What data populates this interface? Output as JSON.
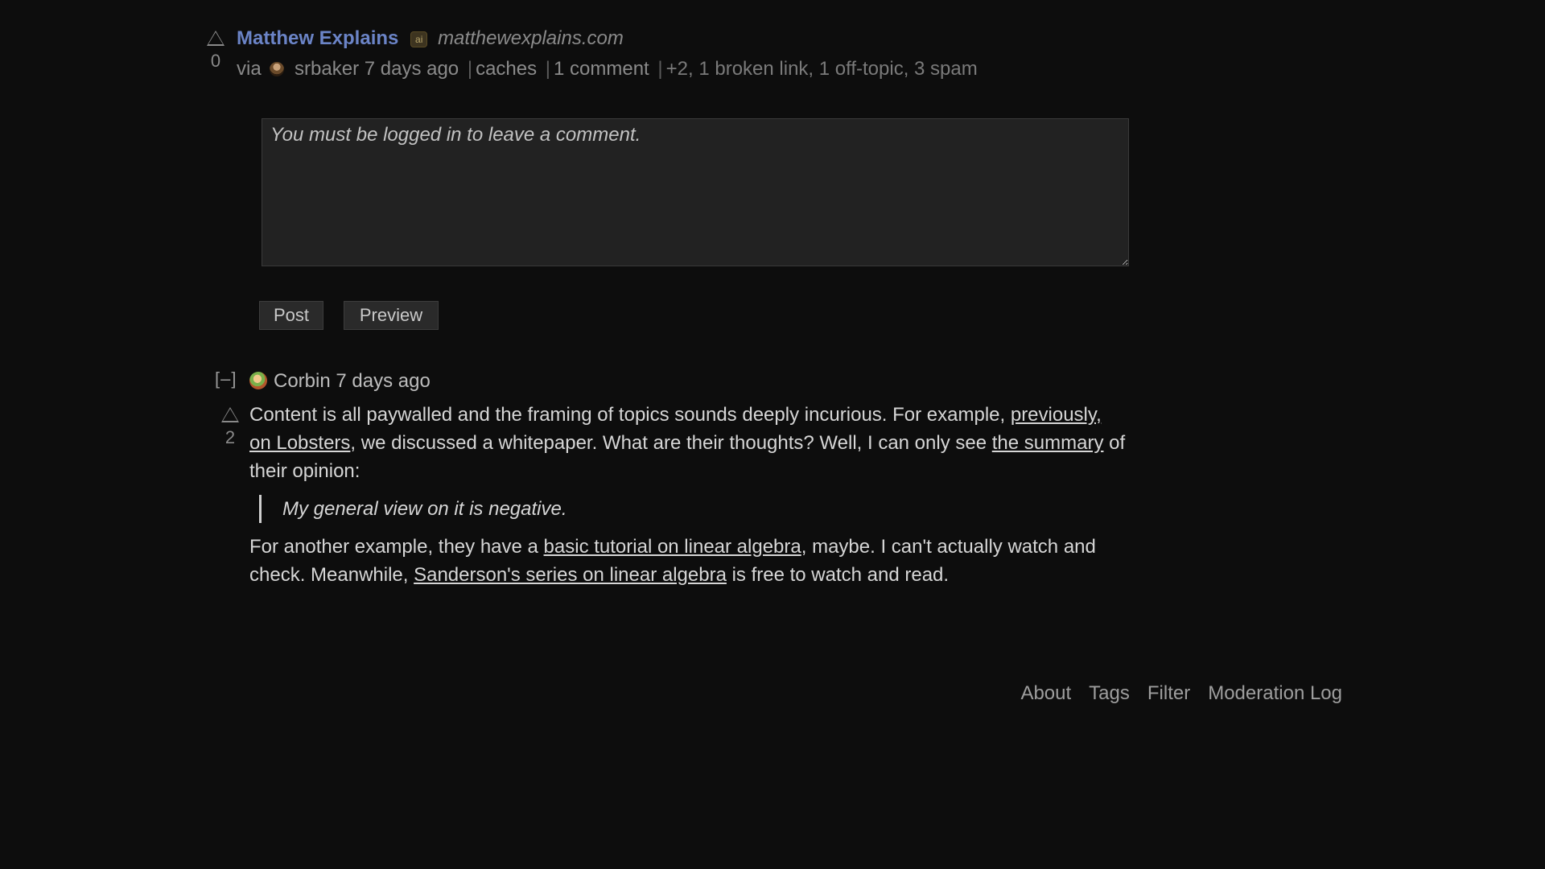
{
  "story": {
    "score": "0",
    "title": "Matthew Explains",
    "tag": "ai",
    "domain": "matthewexplains.com",
    "via_label": "via",
    "submitter": "srbaker",
    "submitted_ago": "7 days ago",
    "caches": "caches",
    "comments": "1 comment",
    "flags": "+2, 1 broken link, 1 off-topic, 3 spam"
  },
  "comment_form": {
    "placeholder": "You must be logged in to leave a comment.",
    "post_label": "Post",
    "preview_label": "Preview"
  },
  "comment": {
    "collapse_label": "[–]",
    "author": "Corbin",
    "time_ago": "7 days ago",
    "score": "2",
    "p1_a": "Content is all paywalled and the framing of topics sounds deeply incurious. For example, ",
    "p1_link1": "previously, on Lobsters",
    "p1_b": ", we discussed a whitepaper. What are their thoughts? Well, I can only see ",
    "p1_link2": "the summary",
    "p1_c": " of their opinion:",
    "quote": "My general view on it is negative.",
    "p2_a": "For another example, they have a ",
    "p2_link1": "basic tutorial on linear algebra",
    "p2_b": ", maybe. I can't actually watch and check. Meanwhile, ",
    "p2_link2": "Sanderson's series on linear algebra",
    "p2_c": " is free to watch and read."
  },
  "footer": {
    "links": [
      "About",
      "Tags",
      "Filter",
      "Moderation Log"
    ]
  }
}
